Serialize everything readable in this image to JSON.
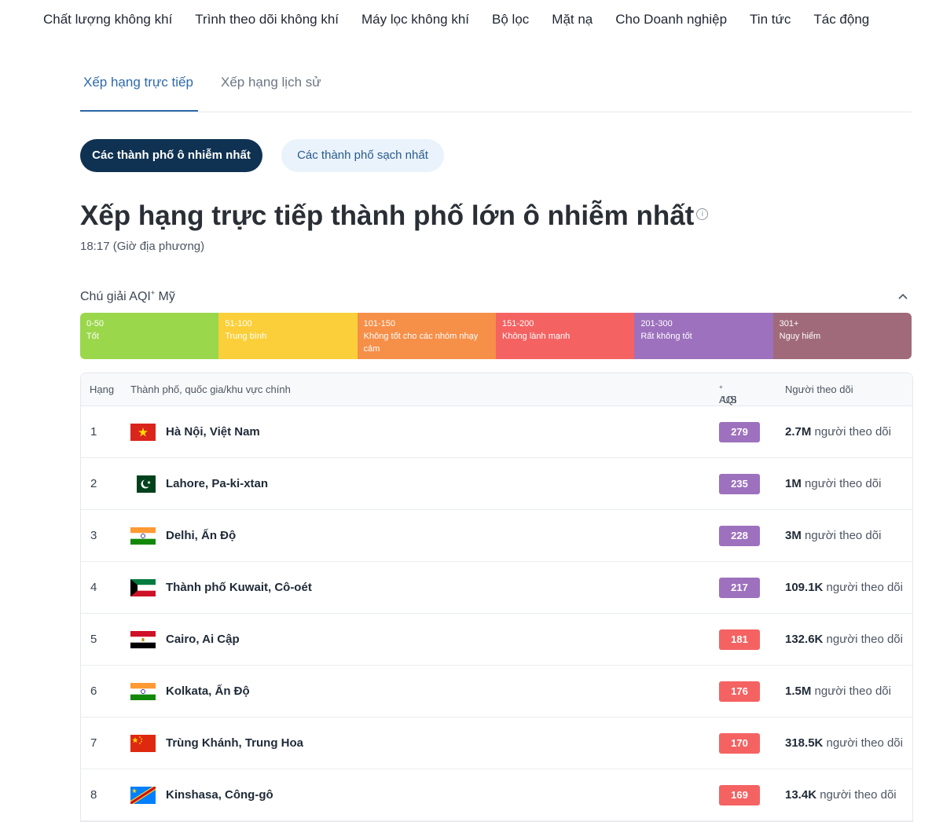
{
  "nav": [
    "Chất lượng không khí",
    "Trình theo dõi không khí",
    "Máy lọc không khí",
    "Bộ lọc",
    "Mặt nạ",
    "Cho Doanh nghiệp",
    "Tin tức",
    "Tác động"
  ],
  "tabs": {
    "live": "Xếp hạng trực tiếp",
    "history": "Xếp hạng lịch sử"
  },
  "pills": {
    "polluted": "Các thành phố ô nhiễm nhất",
    "clean": "Các thành phố sạch nhất"
  },
  "title": "Xếp hạng trực tiếp thành phố lớn ô nhiễm nhất",
  "info_icon": "i",
  "time": "18:17 (Giờ địa phương)",
  "legend": {
    "title_prefix": "Chú giải AQI",
    "title_sup": "+",
    "title_suffix": " Mỹ",
    "segments": [
      {
        "range": "0-50",
        "label": "Tốt",
        "color": "#9bd74b"
      },
      {
        "range": "51-100",
        "label": "Trung bình",
        "color": "#fbcf3a"
      },
      {
        "range": "101-150",
        "label": "Không tốt cho các nhóm nhạy cảm",
        "color": "#f68f48"
      },
      {
        "range": "151-200",
        "label": "Không lành mạnh",
        "color": "#f56262"
      },
      {
        "range": "201-300",
        "label": "Rất không tốt",
        "color": "#9d71bd"
      },
      {
        "range": "301+",
        "label": "Nguy hiểm",
        "color": "#a06a7b"
      }
    ]
  },
  "table": {
    "headers": {
      "rank": "Hạng",
      "city": "Thành phố, quốc gia/khu vực chính",
      "aqi_prefix": "AQI",
      "aqi_sup": "+",
      "aqi_suffix": " US",
      "followers": "Người theo dõi"
    },
    "follower_suffix": " người theo dõi",
    "rows": [
      {
        "rank": "1",
        "city": "Hà Nội, Việt Nam",
        "aqi": "279",
        "followers": "2.7M",
        "flag": "vietnam-flag-icon",
        "color": "#9d71bd"
      },
      {
        "rank": "2",
        "city": "Lahore, Pa-ki-xtan",
        "aqi": "235",
        "followers": "1M",
        "flag": "pakistan-flag-icon",
        "color": "#9d71bd"
      },
      {
        "rank": "3",
        "city": "Delhi, Ấn Độ",
        "aqi": "228",
        "followers": "3M",
        "flag": "india-flag-icon",
        "color": "#9d71bd"
      },
      {
        "rank": "4",
        "city": "Thành phố Kuwait, Cô-oét",
        "aqi": "217",
        "followers": "109.1K",
        "flag": "kuwait-flag-icon",
        "color": "#9d71bd"
      },
      {
        "rank": "5",
        "city": "Cairo, Ai Cập",
        "aqi": "181",
        "followers": "132.6K",
        "flag": "egypt-flag-icon",
        "color": "#f56262"
      },
      {
        "rank": "6",
        "city": "Kolkata, Ấn Độ",
        "aqi": "176",
        "followers": "1.5M",
        "flag": "india-flag-icon",
        "color": "#f56262"
      },
      {
        "rank": "7",
        "city": "Trùng Khánh, Trung Hoa",
        "aqi": "170",
        "followers": "318.5K",
        "flag": "china-flag-icon",
        "color": "#f56262"
      },
      {
        "rank": "8",
        "city": "Kinshasa, Công-gô",
        "aqi": "169",
        "followers": "13.4K",
        "flag": "congo-flag-icon",
        "color": "#f56262"
      }
    ]
  }
}
